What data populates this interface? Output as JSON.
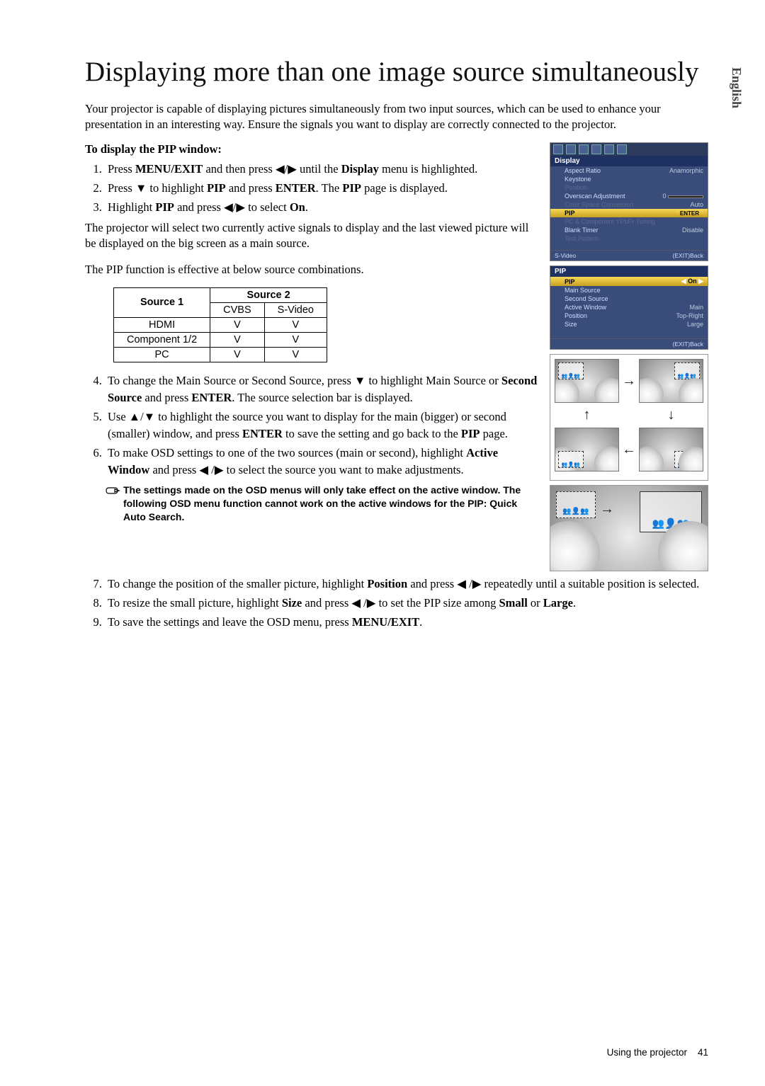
{
  "language_tab": "English",
  "title": "Displaying more than one image source simultaneously",
  "intro": "Your projector is capable of displaying pictures simultaneously from two input sources, which can be used to enhance your presentation in an interesting way. Ensure the signals you want to display are correctly connected to the projector.",
  "subhead": "To display the PIP window:",
  "list_a": {
    "i1_pre": "Press ",
    "i1_b1": "MENU/EXIT",
    "i1_mid": " and then press ◀/▶ until the ",
    "i1_b2": "Display",
    "i1_post": " menu is highlighted.",
    "i2_pre": "Press ▼ to highlight ",
    "i2_b1": "PIP",
    "i2_mid": " and press ",
    "i2_b2": "ENTER",
    "i2_post": ". The ",
    "i2_b3": "PIP",
    "i2_end": " page is displayed.",
    "i3_pre": "Highlight ",
    "i3_b1": "PIP",
    "i3_mid": " and press ◀/▶ to select ",
    "i3_b2": "On",
    "i3_post": "."
  },
  "para2": "The projector will select two currently active signals to display and the last viewed picture will be displayed on the big screen as a main source.",
  "para3": "The PIP function is effective at below source combinations.",
  "table": {
    "h_source1": "Source 1",
    "h_source2": "Source 2",
    "c_cvbs": "CVBS",
    "c_svideo": "S-Video",
    "rows": [
      {
        "name": "HDMI",
        "a": "V",
        "b": "V"
      },
      {
        "name": "Component 1/2",
        "a": "V",
        "b": "V"
      },
      {
        "name": "PC",
        "a": "V",
        "b": "V"
      }
    ]
  },
  "list_b": {
    "i4": "To change the Main Source or Second Source, press ▼ to highlight Main Source or ",
    "i4_b": "Second Source",
    "i4_mid": " and press ",
    "i4_b2": "ENTER",
    "i4_post": ". The source selection bar is displayed.",
    "i5": "Use ▲/▼ to highlight the source you want to display for the main (bigger) or second (smaller) window, and press ",
    "i5_b": "ENTER",
    "i5_mid": " to save the setting and go back to the ",
    "i5_b2": "PIP",
    "i5_post": " page.",
    "i6": "To make OSD settings to one of the two sources (main or second), highlight ",
    "i6_b": "Active Window",
    "i6_mid": " and press ◀ /▶ to select the source you want to make adjustments."
  },
  "note": "The settings made on the OSD menus will only take effect on the active window. The following OSD menu function cannot work on the active windows for the PIP: Quick Auto Search.",
  "list_c": {
    "i7_pre": "To change the position of the smaller picture, highlight ",
    "i7_b": "Position",
    "i7_post": " and press ◀ /▶ repeatedly until a suitable position is selected.",
    "i8_pre": "To resize the small picture, highlight ",
    "i8_b": "Size",
    "i8_mid": " and press ◀ /▶ to set the PIP size among ",
    "i8_b2": "Small",
    "i8_or": " or ",
    "i8_b3": "Large",
    "i8_post": ".",
    "i9_pre": "To save the settings and leave the OSD menu, press ",
    "i9_b": "MENU/EXIT",
    "i9_post": "."
  },
  "footer_section": "Using the projector",
  "footer_page": "41",
  "osd1": {
    "title": "Display",
    "r1": {
      "label": "Aspect Ratio",
      "val": "Anamorphic"
    },
    "r2": {
      "label": "Keystone",
      "val": ""
    },
    "r3": {
      "label": "Position",
      "val": ""
    },
    "r4": {
      "label": "Overscan Adjustment",
      "val": "0"
    },
    "r5": {
      "label": "Color Space Conversion",
      "val": "Auto"
    },
    "r6": {
      "label": "PIP",
      "val": "ENTER"
    },
    "r7": {
      "label": "PC & Component YPbPr Tuning",
      "val": ""
    },
    "r8": {
      "label": "Blank Timer",
      "val": "Disable"
    },
    "r9": {
      "label": "Test Pattern",
      "val": ""
    },
    "src": "S-Video",
    "back": "(EXIT)Back"
  },
  "osd2": {
    "title": "PIP",
    "r1": {
      "label": "PIP",
      "val": "On"
    },
    "r2": {
      "label": "Main Source",
      "val": ""
    },
    "r3": {
      "label": "Second Source",
      "val": ""
    },
    "r4": {
      "label": "Active Window",
      "val": "Main"
    },
    "r5": {
      "label": "Position",
      "val": "Top-Right"
    },
    "r6": {
      "label": "Size",
      "val": "Large"
    },
    "back": "(EXIT)Back"
  }
}
